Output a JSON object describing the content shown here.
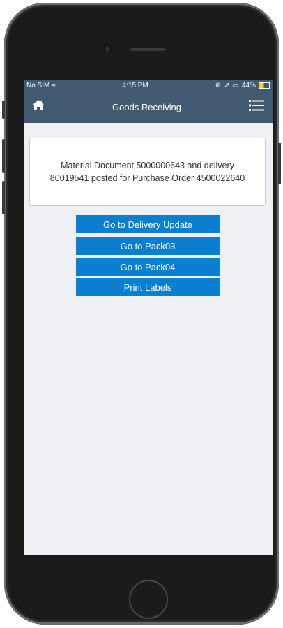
{
  "status_bar": {
    "carrier": "No SIM",
    "time": "4:15 PM",
    "battery": "44%"
  },
  "nav": {
    "title": "Goods Receiving",
    "home_icon": "home-icon",
    "menu_icon": "list-menu-icon"
  },
  "message": {
    "line1": "Material Document 5000000643 and delivery",
    "line2": "80019541 posted for Purchase Order 4500022640"
  },
  "actions": [
    {
      "label": "Go to Delivery Update"
    },
    {
      "label": "Go to Pack03"
    },
    {
      "label": "Go to Pack04"
    },
    {
      "label": "Print Labels"
    }
  ],
  "colors": {
    "header": "#415a72",
    "button": "#0a7fd0",
    "screen_bg": "#eef0f4"
  }
}
